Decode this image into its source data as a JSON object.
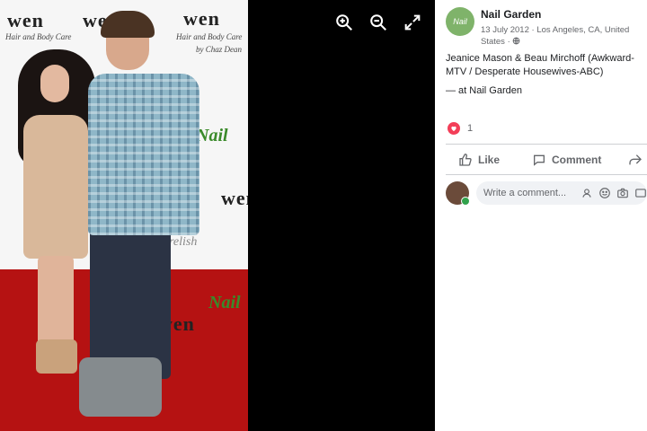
{
  "photo": {
    "brands": [
      "wen",
      "wen",
      "wen",
      "wen",
      "wen"
    ],
    "brand_sub": "Hair and Body Care",
    "brand_sub2": "by Chaz Dean",
    "nail_logo": "Nail",
    "relish": "relish"
  },
  "viewer": {
    "icons": [
      "zoom-in-icon",
      "zoom-out-icon",
      "fullscreen-icon"
    ]
  },
  "post": {
    "page_name": "Nail Garden",
    "date": "13 July 2012",
    "location_meta": "Los Angeles, CA, United States",
    "separator": "·",
    "caption": "Jeanice Mason & Beau Mirchoff (Awkward-MTV / Desperate Housewives-ABC)",
    "location_line": "— at Nail Garden",
    "reaction_count": "1",
    "like_label": "Like",
    "comment_label": "Comment",
    "comment_placeholder": "Write a comment...",
    "avatar_text": "Nail"
  },
  "colors": {
    "carpet": "#b51212",
    "accent_green": "#3a8a2a",
    "reaction_heart": "#f33e58"
  }
}
